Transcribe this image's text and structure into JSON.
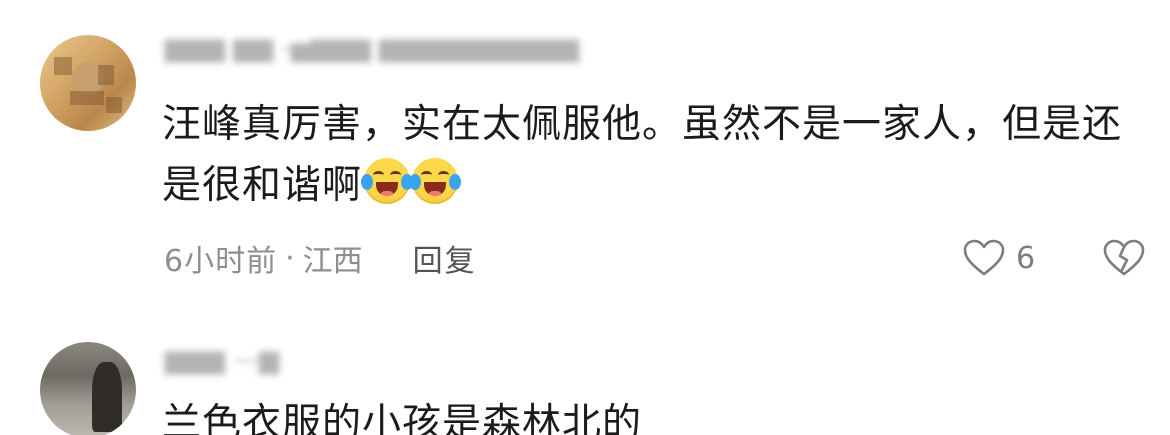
{
  "comments": [
    {
      "username": "▆▆▆ ▆▆ -▅▆▆▆ ▆▆▆▆▆▆▆▆▆▆",
      "text": "汪峰真厉害，实在太佩服他。虽然不是一家人，但是还是很和谐啊",
      "emojis": [
        "laugh-cry-emoji",
        "laugh-cry-emoji"
      ],
      "time": "6小时前",
      "separator": "·",
      "location": "江西",
      "reply_label": "回复",
      "like_count": "6",
      "icons": {
        "like": "heart-outline-icon",
        "dislike": "broken-heart-icon"
      }
    },
    {
      "username": "▆▆▆ —▆",
      "text": "兰色衣服的小孩是森林北的"
    }
  ],
  "colors": {
    "text": "#1b1b1b",
    "meta": "#8e8e8e",
    "reply": "#555555",
    "icon": "#7d7d7d",
    "emoji_face": "#ffd84a",
    "emoji_tear": "#3aa3f0"
  }
}
